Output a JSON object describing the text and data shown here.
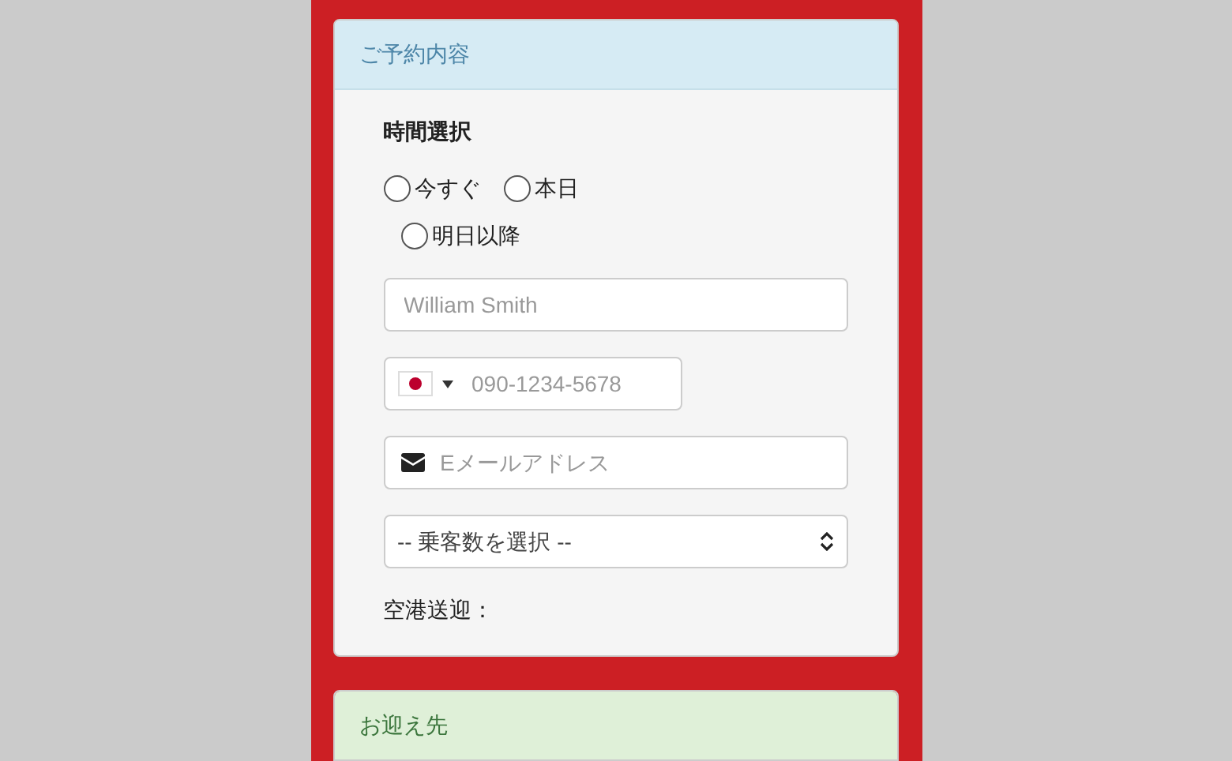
{
  "reservation_panel": {
    "title": "ご予約内容",
    "time_label": "時間選択",
    "time_options": [
      {
        "label": "今すぐ",
        "selected": false
      },
      {
        "label": "本日",
        "selected": false
      },
      {
        "label": "明日以降",
        "selected": false
      }
    ],
    "name_field": {
      "placeholder": "William Smith"
    },
    "phone_field": {
      "placeholder": "090-1234-5678"
    },
    "email_field": {
      "placeholder": "Eメールアドレス"
    },
    "passengers_select": {
      "value": "-- 乗客数を選択 --"
    },
    "airport_transfer_label": "空港送迎："
  },
  "pickup_panel": {
    "title": "お迎え先"
  }
}
